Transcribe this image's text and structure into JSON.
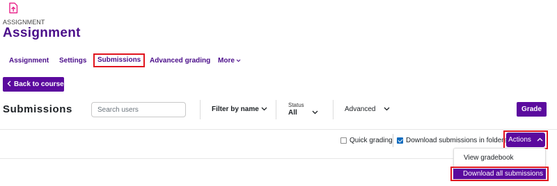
{
  "header": {
    "overline": "ASSIGNMENT",
    "title": "Assignment"
  },
  "nav": {
    "tabs": [
      "Assignment",
      "Settings",
      "Submissions",
      "Advanced grading",
      "More"
    ],
    "active": "Submissions"
  },
  "back_button": "Back to course",
  "submissions": {
    "heading": "Submissions",
    "search_placeholder": "Search users",
    "filter_label": "Filter by name",
    "status_label": "Status",
    "status_value": "All",
    "advanced_label": "Advanced",
    "grade_button": "Grade"
  },
  "options": {
    "quick_grading": {
      "label": "Quick grading",
      "checked": false
    },
    "download_folders": {
      "label": "Download submissions in folders",
      "checked": true
    },
    "actions_button": "Actions"
  },
  "actions_menu": {
    "items": [
      "View gradebook",
      "Download all submissions"
    ],
    "highlighted": "Download all submissions"
  },
  "colors": {
    "brand": "#5b0a9e",
    "link": "#4b0e8a",
    "highlight_outline": "#e0141e",
    "checkbox": "#0f6cbf"
  }
}
